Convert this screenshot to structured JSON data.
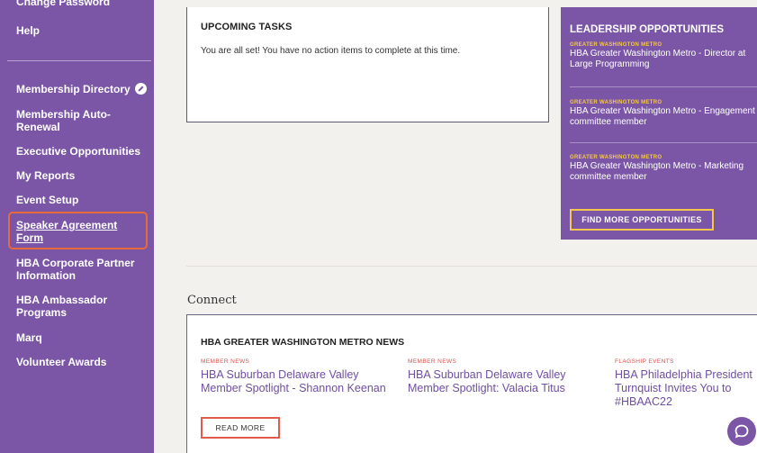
{
  "sidebar": {
    "items": [
      {
        "label": "Change Password"
      },
      {
        "label": "Help"
      },
      {
        "label": "Membership Directory"
      },
      {
        "label": "Membership Auto-Renewal"
      },
      {
        "label": "Executive Opportunities"
      },
      {
        "label": "My Reports"
      },
      {
        "label": "Event Setup"
      },
      {
        "label": "Speaker Agreement Form"
      },
      {
        "label": "HBA Corporate Partner Information"
      },
      {
        "label": "HBA Ambassador Programs"
      },
      {
        "label": "Marq"
      },
      {
        "label": "Volunteer Awards"
      }
    ]
  },
  "tasks": {
    "title": "UPCOMING TASKS",
    "message": "You are all set! You have no action items to complete at this time."
  },
  "leadership": {
    "title": "LEADERSHIP OPPORTUNITIES",
    "items": [
      {
        "tag": "GREATER WASHINGTON METRO",
        "text": "HBA Greater Washington Metro - Director at Large Programming"
      },
      {
        "tag": "GREATER WASHINGTON METRO",
        "text": "HBA Greater Washington Metro - Engagement committee member"
      },
      {
        "tag": "GREATER WASHINGTON METRO",
        "text": "HBA Greater Washington Metro - Marketing committee member"
      }
    ],
    "button": "FIND MORE OPPORTUNITIES"
  },
  "connect": {
    "label": "Connect"
  },
  "news": {
    "title": "HBA GREATER WASHINGTON METRO NEWS",
    "items": [
      {
        "tag": "MEMBER NEWS",
        "headline": "HBA Suburban Delaware Valley Member Spotlight - Shannon Keenan"
      },
      {
        "tag": "MEMBER NEWS",
        "headline": "HBA Suburban Delaware Valley Member Spotlight: Valacia Titus"
      },
      {
        "tag": "FLAGSHIP EVENTS",
        "headline": "HBA Philadelphia President Turnquist Invites You to #HBAAC22"
      }
    ],
    "read_more": "READ MORE"
  },
  "icons": {
    "directory_badge": "pencil-check-icon",
    "chat": "chat-bubble-icon"
  },
  "colors": {
    "brand_purple": "#7b56a6",
    "accent_yellow": "#f5c84b",
    "highlight_orange": "#e66a3b",
    "news_red": "#d9534f"
  }
}
